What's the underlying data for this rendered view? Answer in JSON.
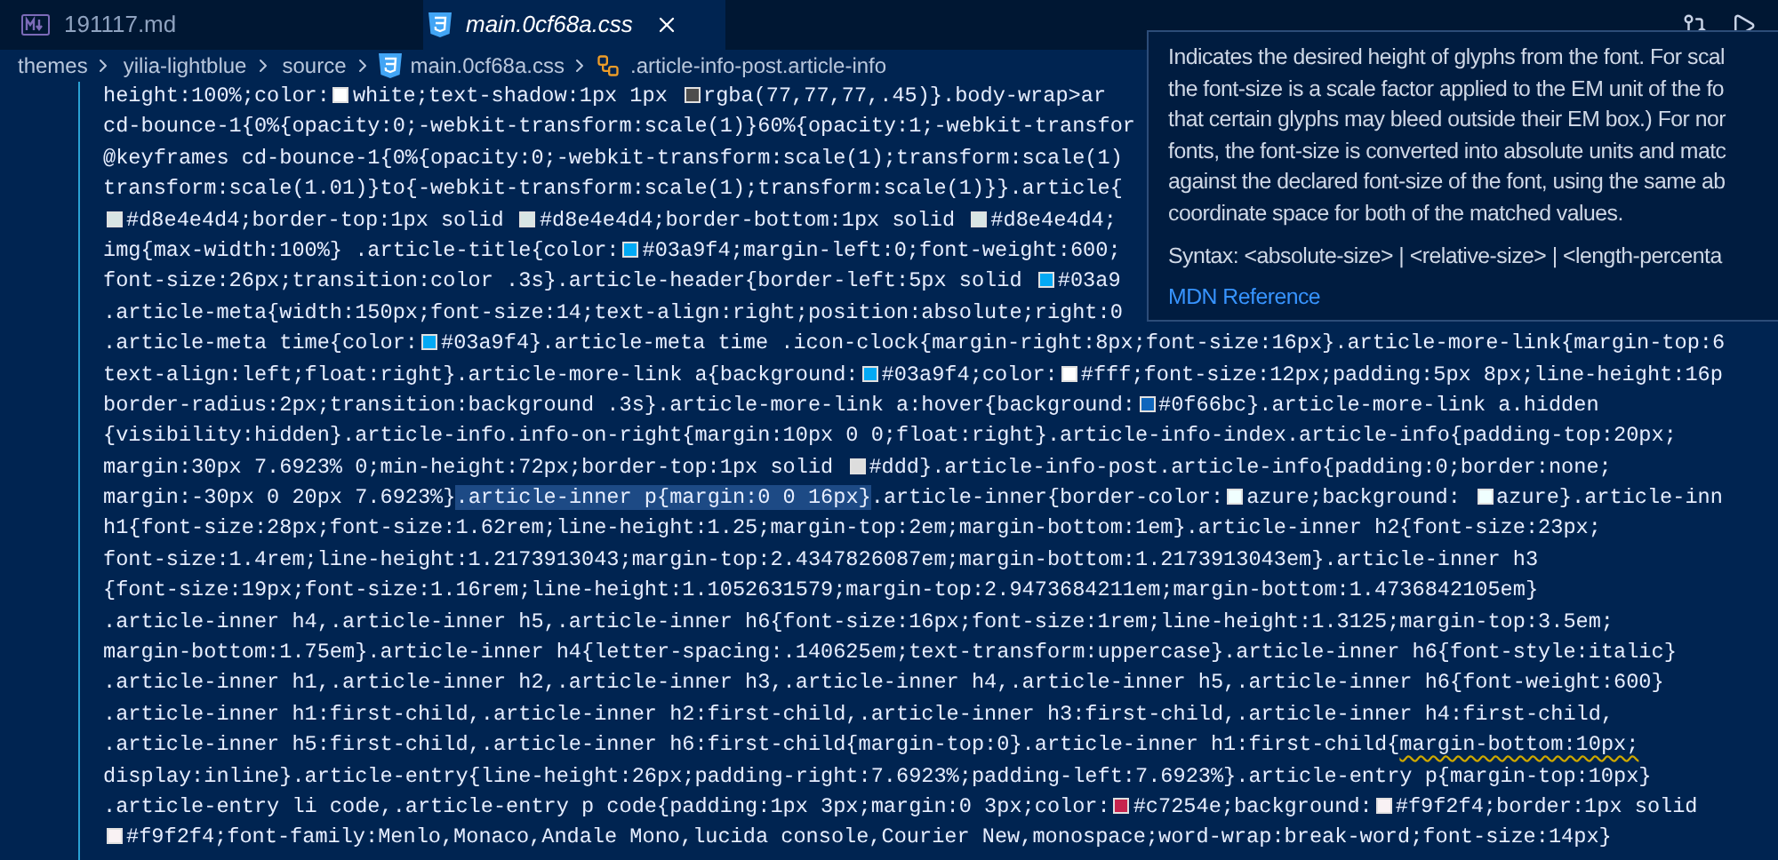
{
  "tabs": [
    {
      "label": "191117.md",
      "kind": "markdown",
      "selected": false,
      "preview": false
    },
    {
      "label": "main.0cf68a.css",
      "kind": "css",
      "selected": true,
      "preview": true
    }
  ],
  "breadcrumb": [
    {
      "label": "themes",
      "kind": "folder"
    },
    {
      "label": "yilia-lightblue",
      "kind": "folder"
    },
    {
      "label": "source",
      "kind": "folder"
    },
    {
      "label": "main.0cf68a.css",
      "kind": "css"
    },
    {
      "label": ".article-info-post.article-info",
      "kind": "symbol"
    }
  ],
  "code_lines": [
    {
      "segments": [
        {
          "kind": "text",
          "text": "height:100%;color:"
        },
        {
          "kind": "swatch",
          "color": "#ffffff"
        },
        {
          "kind": "text",
          "text": "white;text-shadow:1px 1px "
        },
        {
          "kind": "swatch",
          "color": "#4d4d4d"
        },
        {
          "kind": "text",
          "text": "rgba(77,77,77,.45)}.body-wrap>ar"
        }
      ]
    },
    {
      "segments": [
        {
          "kind": "text",
          "text": "cd-bounce-1{0%{opacity:0;-webkit-transform:scale(1)}60%{opacity:1;-webkit-transfor"
        }
      ]
    },
    {
      "segments": [
        {
          "kind": "text",
          "text": "@keyframes cd-bounce-1{0%{opacity:0;-webkit-transform:scale(1);transform:scale(1)"
        }
      ]
    },
    {
      "segments": [
        {
          "kind": "text",
          "text": "transform:scale(1.01)}to{-webkit-transform:scale(1);transform:scale(1)}}.article{"
        }
      ]
    },
    {
      "segments": [
        {
          "kind": "swatch",
          "color": "#d8e4e4"
        },
        {
          "kind": "text",
          "text": "#d8e4e4d4;border-top:1px solid "
        },
        {
          "kind": "swatch",
          "color": "#d8e4e4"
        },
        {
          "kind": "text",
          "text": "#d8e4e4d4;border-bottom:1px solid "
        },
        {
          "kind": "swatch",
          "color": "#d8e4e4"
        },
        {
          "kind": "text",
          "text": "#d8e4e4d4;"
        }
      ]
    },
    {
      "segments": [
        {
          "kind": "text",
          "text": "img{max-width:100%} .article-title{color:"
        },
        {
          "kind": "swatch",
          "color": "#03a9f4"
        },
        {
          "kind": "text",
          "text": "#03a9f4;margin-left:0;font-weight:600;"
        }
      ]
    },
    {
      "segments": [
        {
          "kind": "text",
          "text": "font-size:26px;transition:color .3s}.article-header{border-left:5px solid "
        },
        {
          "kind": "swatch",
          "color": "#03a9f4"
        },
        {
          "kind": "text",
          "text": "#03a9"
        }
      ]
    },
    {
      "segments": [
        {
          "kind": "text",
          "text": ".article-meta{width:150px;font-size:14;text-align:right;position:absolute;right:0"
        }
      ]
    },
    {
      "segments": [
        {
          "kind": "text",
          "text": ".article-meta time{color:"
        },
        {
          "kind": "swatch",
          "color": "#03a9f4"
        },
        {
          "kind": "text",
          "text": "#03a9f4}.article-meta time .icon-clock{margin-right:8px;font-size:16px}.article-more-link{margin-top:6"
        }
      ]
    },
    {
      "segments": [
        {
          "kind": "text",
          "text": "text-align:left;float:right}.article-more-link a{background:"
        },
        {
          "kind": "swatch",
          "color": "#03a9f4"
        },
        {
          "kind": "text",
          "text": "#03a9f4;color:"
        },
        {
          "kind": "swatch",
          "color": "#ffffff"
        },
        {
          "kind": "text",
          "text": "#fff;font-size:12px;padding:5px 8px;line-height:16p"
        }
      ]
    },
    {
      "segments": [
        {
          "kind": "text",
          "text": "border-radius:2px;transition:background .3s}.article-more-link a:hover{background:"
        },
        {
          "kind": "swatch",
          "color": "#0f66bc"
        },
        {
          "kind": "text",
          "text": "#0f66bc}.article-more-link a.hidden"
        }
      ]
    },
    {
      "segments": [
        {
          "kind": "text",
          "text": "{visibility:hidden}.article-info.info-on-right{margin:10px 0 0;float:right}.article-info-index.article-info{padding-top:20px;"
        }
      ]
    },
    {
      "segments": [
        {
          "kind": "text",
          "text": "margin:30px 7.6923% 0;min-height:72px;border-top:1px solid "
        },
        {
          "kind": "swatch",
          "color": "#dddddd"
        },
        {
          "kind": "text",
          "text": "#ddd}.article-info-post.article-info{padding:0;border:none;"
        }
      ]
    },
    {
      "segments": [
        {
          "kind": "text",
          "text": "margin:-30px 0 20px 7.6923%}"
        },
        {
          "kind": "match",
          "text": ".article-inner p{margin:0 0 16px}"
        },
        {
          "kind": "text",
          "text": ".article-inner{border-color:"
        },
        {
          "kind": "swatch",
          "color": "#f0ffff"
        },
        {
          "kind": "text",
          "text": "azure;background: "
        },
        {
          "kind": "swatch",
          "color": "#f0ffff"
        },
        {
          "kind": "text",
          "text": "azure}.article-inn"
        }
      ]
    },
    {
      "segments": [
        {
          "kind": "text",
          "text": "h1{font-size:28px;font-size:1.62rem;line-height:1.25;margin-top:2em;margin-bottom:1em}.article-inner h2{font-size:23px;"
        }
      ]
    },
    {
      "segments": [
        {
          "kind": "text",
          "text": "font-size:1.4rem;line-height:1.2173913043;margin-top:2.4347826087em;margin-bottom:1.2173913043em}.article-inner h3"
        }
      ]
    },
    {
      "segments": [
        {
          "kind": "text",
          "text": "{font-size:19px;font-size:1.16rem;line-height:1.1052631579;margin-top:2.9473684211em;margin-bottom:1.4736842105em}"
        }
      ]
    },
    {
      "segments": [
        {
          "kind": "text",
          "text": ".article-inner h4,.article-inner h5,.article-inner h6{font-size:16px;font-size:1rem;line-height:1.3125;margin-top:3.5em;"
        }
      ]
    },
    {
      "segments": [
        {
          "kind": "text",
          "text": "margin-bottom:1.75em}.article-inner h4{letter-spacing:.140625em;text-transform:uppercase}.article-inner h6{font-style:italic}"
        }
      ]
    },
    {
      "segments": [
        {
          "kind": "text",
          "text": ".article-inner h1,.article-inner h2,.article-inner h3,.article-inner h4,.article-inner h5,.article-inner h6{font-weight:600}"
        }
      ]
    },
    {
      "segments": [
        {
          "kind": "text",
          "text": ".article-inner h1:first-child,.article-inner h2:first-child,.article-inner h3:first-child,.article-inner h4:first-child,"
        }
      ]
    },
    {
      "segments": [
        {
          "kind": "text",
          "text": ".article-inner h5:first-child,.article-inner h6:first-child{margin-top:0}.article-inner h1:first-child{"
        },
        {
          "kind": "warning",
          "text": "margin-bottom:10px;"
        }
      ]
    },
    {
      "segments": [
        {
          "kind": "text",
          "text": "display:inline}.article-entry{line-height:26px;padding-right:7.6923%;padding-left:7.6923%}.article-entry p{margin-top:10px}"
        }
      ]
    },
    {
      "segments": [
        {
          "kind": "text",
          "text": ".article-entry li code,.article-entry p code{padding:1px 3px;margin:0 3px;color:"
        },
        {
          "kind": "swatch",
          "color": "#c7254e"
        },
        {
          "kind": "text",
          "text": "#c7254e;background:"
        },
        {
          "kind": "swatch",
          "color": "#f9f2f4"
        },
        {
          "kind": "text",
          "text": "#f9f2f4;border:1px solid"
        }
      ]
    },
    {
      "segments": [
        {
          "kind": "swatch",
          "color": "#f9f2f4"
        },
        {
          "kind": "text",
          "text": "#f9f2f4;font-family:Menlo,Monaco,Andale Mono,lucida console,Courier New,monospace;word-wrap:break-word;font-size:14px}"
        }
      ]
    }
  ],
  "hover_tooltip": {
    "description_lines": [
      "Indicates the desired height of glyphs from the font. For scal",
      "the font-size is a scale factor applied to the EM unit of the fo",
      "that certain glyphs may bleed outside their EM box.) For nor",
      "fonts, the font-size is converted into absolute units and matc",
      "against the declared font-size of the font, using the same ab",
      "coordinate space for both of the matched values."
    ],
    "syntax": "Syntax: <absolute-size> | <relative-size> | <length-percenta",
    "link": "MDN Reference"
  }
}
